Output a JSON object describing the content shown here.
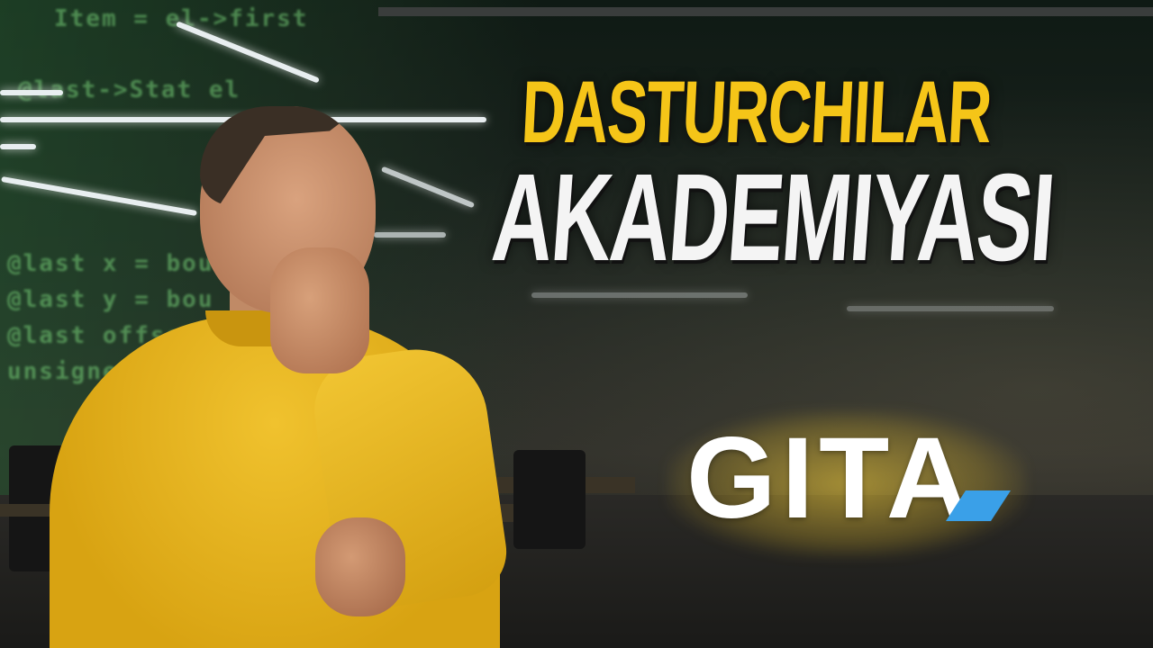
{
  "headline": {
    "line1": "DASTURCHILAR",
    "line2": "AKADEMIYASI"
  },
  "logo": {
    "text": "GITA",
    "mark_icon": "blue-parallelogram-icon",
    "mark_color": "#3aa0e8",
    "glow_color": "#f5c518"
  },
  "background_code": [
    "Item = el->first",
    "@last->Stat el",
    "@last x = bou",
    "@last y = bou",
    "@last offset",
    "unsigned t"
  ],
  "colors": {
    "headline_yellow": "#f5c518",
    "headline_white": "#f4f4f4",
    "sweater": "#e8b51f"
  }
}
